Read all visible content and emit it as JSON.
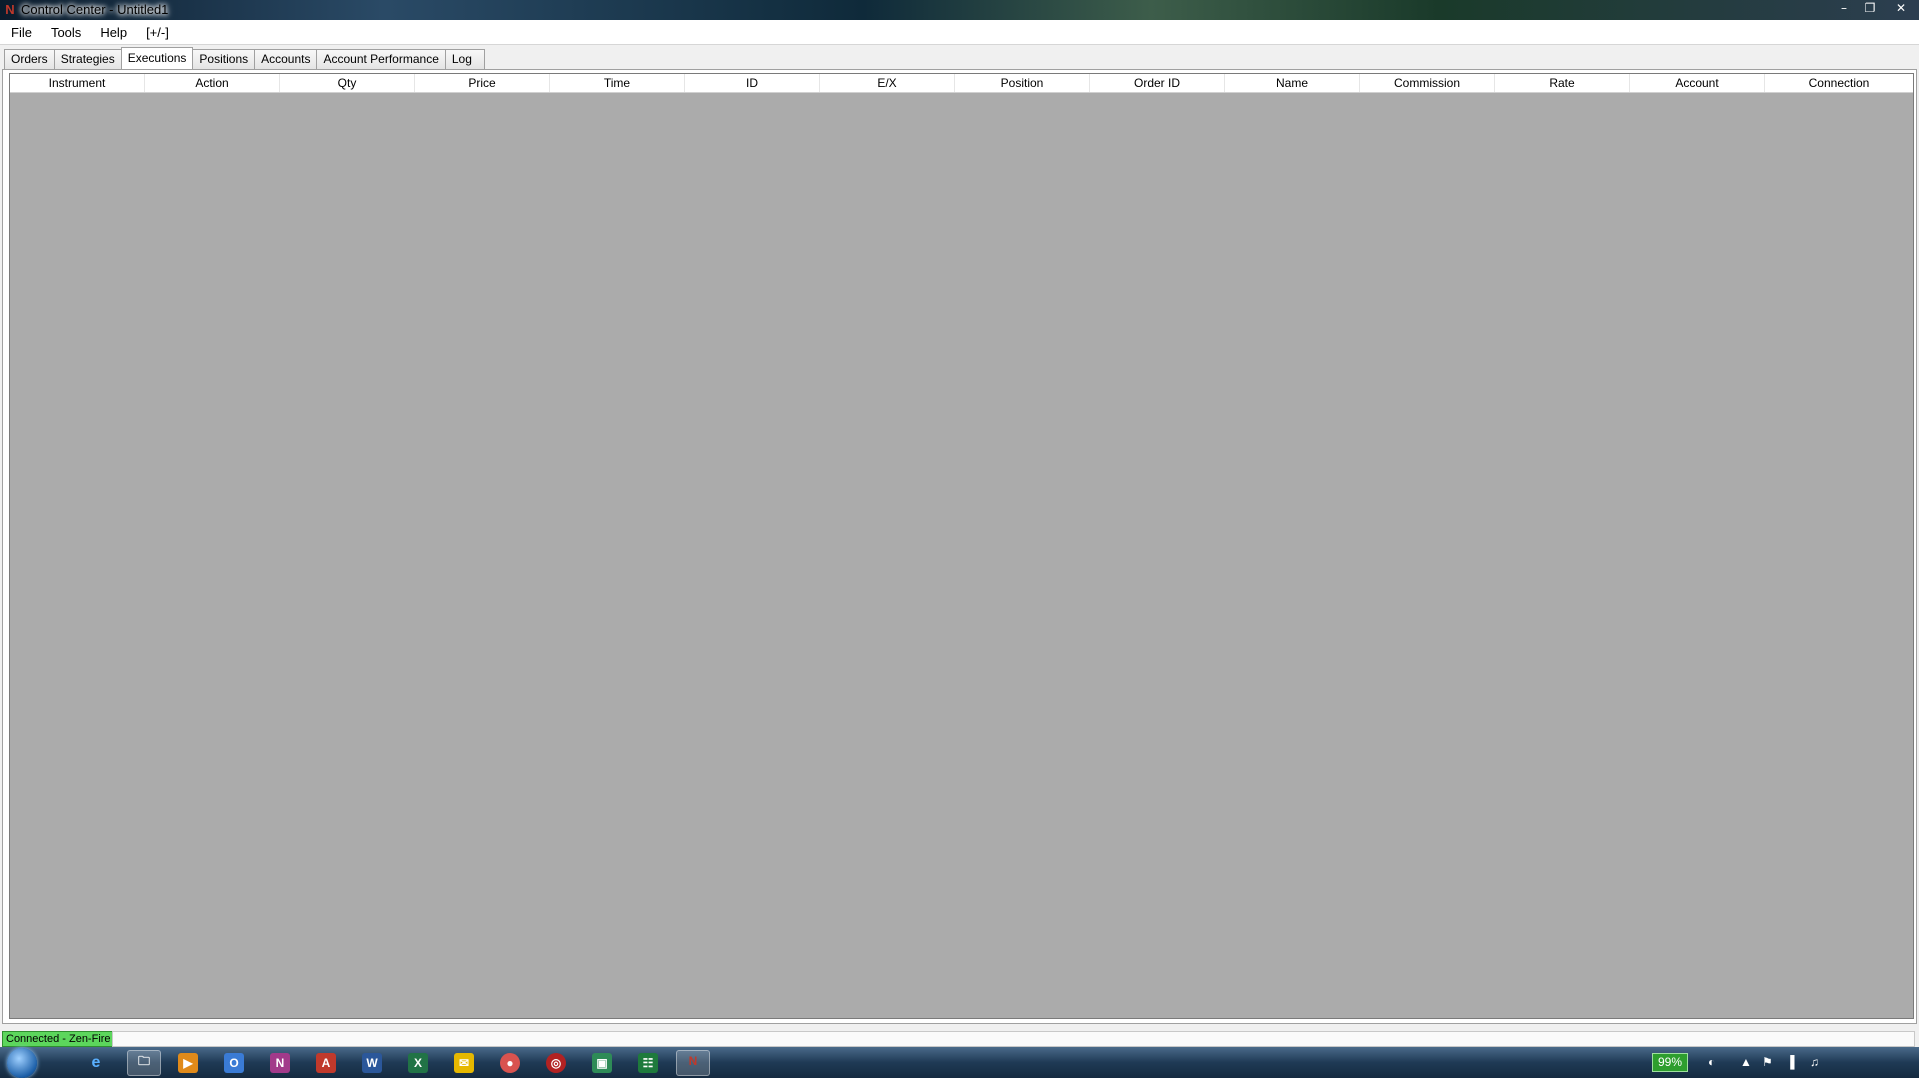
{
  "window": {
    "title": "Control Center - Untitled1",
    "icon": "ninjatrader-logo-icon",
    "controls": [
      "minimize-icon",
      "restore-icon",
      "close-icon"
    ]
  },
  "menu": {
    "items": [
      {
        "label": "File"
      },
      {
        "label": "Tools"
      },
      {
        "label": "Help"
      },
      {
        "label": "[+/-]"
      }
    ]
  },
  "tabs": [
    {
      "label": "Orders",
      "active": false
    },
    {
      "label": "Strategies",
      "active": false
    },
    {
      "label": "Executions",
      "active": true
    },
    {
      "label": "Positions",
      "active": false
    },
    {
      "label": "Accounts",
      "active": false
    },
    {
      "label": "Account Performance",
      "active": false
    },
    {
      "label": "Log",
      "active": false
    }
  ],
  "grid": {
    "columns": [
      "Instrument",
      "Action",
      "Qty",
      "Price",
      "Time",
      "ID",
      "E/X",
      "Position",
      "Order ID",
      "Name",
      "Commission",
      "Rate",
      "Account",
      "Connection"
    ],
    "rows": []
  },
  "status": {
    "connection": "Connected - Zen-Fire",
    "connection_color": "#5cd65c"
  },
  "taskbar": {
    "pinned": [
      "internet-explorer-icon",
      "file-explorer-icon",
      "media-player-icon",
      "outlook-icon",
      "notes-icon",
      "pdf-icon",
      "word-icon",
      "excel-icon",
      "mail-icon",
      "chrome-icon",
      "antivirus-icon",
      "network-tool-icon",
      "spreadsheet-tool-icon",
      "ninjatrader-icon"
    ],
    "battery": "99%"
  }
}
